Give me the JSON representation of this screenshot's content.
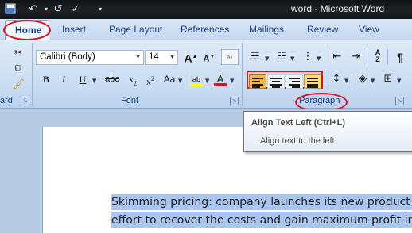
{
  "window": {
    "title": "word - Microsoft Word"
  },
  "quick_access": {
    "save_icon": "save-icon",
    "undo_icon": "undo-icon",
    "redo_icon": "redo-icon",
    "spelling_icon": "spelling-check-icon",
    "customize_icon": "customize-dropdown-icon"
  },
  "tabs": [
    {
      "label": "Home",
      "active": true
    },
    {
      "label": "Insert"
    },
    {
      "label": "Page Layout"
    },
    {
      "label": "References"
    },
    {
      "label": "Mailings"
    },
    {
      "label": "Review"
    },
    {
      "label": "View"
    }
  ],
  "clipboard": {
    "label_partial": "ard"
  },
  "font": {
    "family": "Calibri (Body)",
    "size": "14",
    "group_label": "Font",
    "grow": "A",
    "shrink": "A",
    "bold": "B",
    "italic": "I",
    "underline": "U",
    "strike": "abc",
    "subscript": "x",
    "subscript_small": "2",
    "superscript": "x",
    "superscript_small": "2",
    "change_case": "Aa",
    "font_color": "A",
    "highlight": "ab"
  },
  "paragraph": {
    "group_label": "Paragraph",
    "sort_label": "A",
    "sort_label2": "Z",
    "pilcrow": "¶"
  },
  "tooltip": {
    "title": "Align Text Left (Ctrl+L)",
    "description": "Align text to the left."
  },
  "document": {
    "lines": [
      "Skimming pricing:  company launches its new product a",
      "effort to recover the costs and gain maximum profit in"
    ]
  },
  "colors": {
    "highlight_red": "#e0101f",
    "font_color_red": "#e0101f",
    "selection": "#a9c6ee"
  }
}
